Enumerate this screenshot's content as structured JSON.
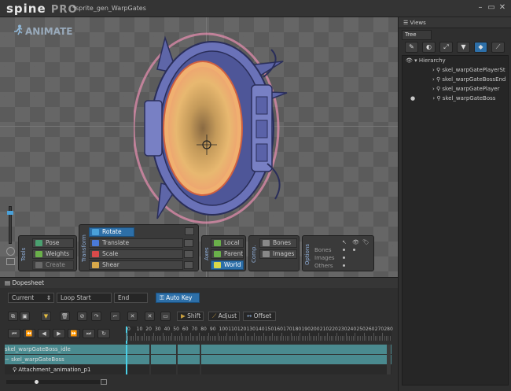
{
  "app": {
    "logo": "spine",
    "logo_suffix": "PRO",
    "title": "*sprite_gen_WarpGates"
  },
  "window_buttons": [
    "–",
    "▭",
    "✕"
  ],
  "viewport": {
    "mode_label": "ANIMATE"
  },
  "pose_panel": {
    "side_label": "Tools",
    "buttons": [
      {
        "label": "Pose"
      },
      {
        "label": "Weights"
      },
      {
        "label": "Create"
      }
    ]
  },
  "transform_panel": {
    "side_label": "Transform",
    "buttons": [
      {
        "label": "Rotate"
      },
      {
        "label": "Translate"
      },
      {
        "label": "Scale"
      },
      {
        "label": "Shear"
      }
    ]
  },
  "axes_panel": {
    "side_label": "Axes",
    "buttons": [
      {
        "label": "Local"
      },
      {
        "label": "Parent"
      },
      {
        "label": "World"
      }
    ]
  },
  "compensate_panel": {
    "side_label": "Comp.",
    "buttons": [
      {
        "label": "Bones"
      },
      {
        "label": "Images"
      }
    ]
  },
  "options_panel": {
    "side_label": "Options",
    "rows": [
      {
        "label": "Bones"
      },
      {
        "label": "Images"
      },
      {
        "label": "Others"
      }
    ]
  },
  "right_panel": {
    "views_label": "Views",
    "tree_tab": "Tree",
    "tools": [
      "✎",
      "◐",
      "⤢",
      "▼",
      "◆",
      "⟋"
    ],
    "hierarchy_label": "Hierarchy",
    "items": [
      "skel_warpGatePlayerSt",
      "skel_warpGateBossEnd",
      "skel_warpGatePlayer",
      "skel_warpGateBoss"
    ]
  },
  "dopesheet": {
    "tab_label": "Dopesheet",
    "current_label": "Current",
    "loop_start_label": "Loop Start",
    "end_label": "End",
    "autokey_label": "Auto Key",
    "shift_label": "Shift",
    "adjust_label": "Adjust",
    "offset_label": "Offset",
    "ruler": [
      "0",
      "10",
      "20",
      "30",
      "40",
      "50",
      "60",
      "70",
      "80",
      "90",
      "100",
      "110",
      "120",
      "130",
      "140",
      "150",
      "160",
      "170",
      "180",
      "190",
      "200",
      "210",
      "220",
      "230",
      "240",
      "250",
      "260",
      "270",
      "280"
    ],
    "rows": [
      "skel_warpGateBoss_idle",
      "skel_warpGateBoss",
      "Attachment_animation_p1"
    ]
  },
  "colors": {
    "accent": "#2d6fa8",
    "timeline_row": "#4a8a8f"
  }
}
